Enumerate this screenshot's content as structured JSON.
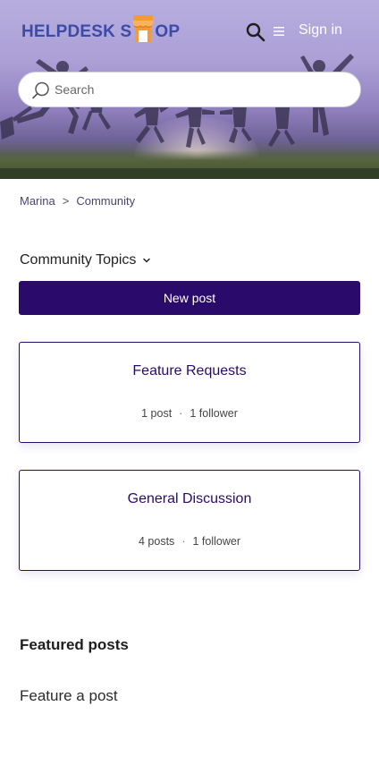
{
  "header": {
    "logo_text_left": "HELPDESK S",
    "logo_text_right": "OP",
    "sign_in": "Sign in",
    "icons": [
      "shop-icon",
      "search-icon",
      "menu-icon"
    ]
  },
  "search": {
    "placeholder": "Search",
    "value": ""
  },
  "breadcrumb": [
    {
      "label": "Marina"
    },
    {
      "label": "Community"
    }
  ],
  "breadcrumb_separator": ">",
  "topics_dropdown": {
    "label": "Community Topics"
  },
  "new_post_label": "New post",
  "topics": [
    {
      "title": "Feature Requests",
      "posts": "1 post",
      "followers": "1 follower"
    },
    {
      "title": "General Discussion",
      "posts": "4 posts",
      "followers": "1 follower"
    }
  ],
  "meta_separator": "·",
  "featured": {
    "heading": "Featured posts",
    "link": "Feature a post"
  },
  "colors": {
    "brand_purple": "#2a0a6b",
    "logo_blue": "#3c4aa8",
    "logo_orange": "#f39a3a"
  }
}
